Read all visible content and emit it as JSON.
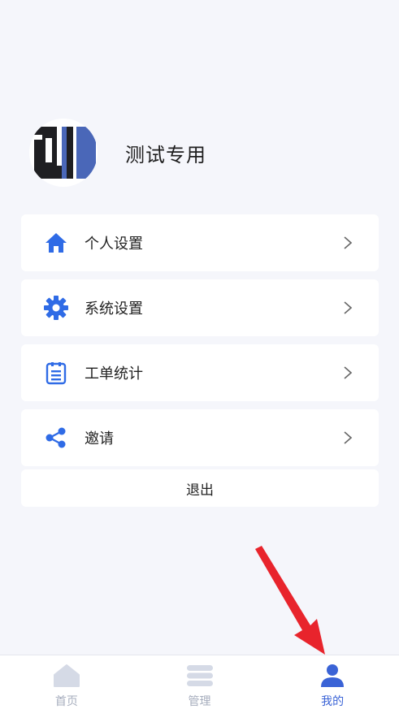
{
  "profile": {
    "username": "测试专用"
  },
  "menu": {
    "items": [
      {
        "label": "个人设置",
        "icon": "home-icon"
      },
      {
        "label": "系统设置",
        "icon": "gear-icon"
      },
      {
        "label": "工单统计",
        "icon": "clipboard-icon"
      },
      {
        "label": "邀请",
        "icon": "share-icon"
      }
    ],
    "logout_label": "退出"
  },
  "tabbar": {
    "tabs": [
      {
        "label": "首页",
        "icon": "home-tab-icon",
        "active": false
      },
      {
        "label": "管理",
        "icon": "stack-tab-icon",
        "active": false
      },
      {
        "label": "我的",
        "icon": "user-tab-icon",
        "active": true
      }
    ]
  },
  "colors": {
    "accent": "#3a63d6",
    "icon_blue": "#2f6be6",
    "inactive": "#a6adbd",
    "background": "#f5f6fb",
    "annotation_arrow": "#e8242c"
  }
}
